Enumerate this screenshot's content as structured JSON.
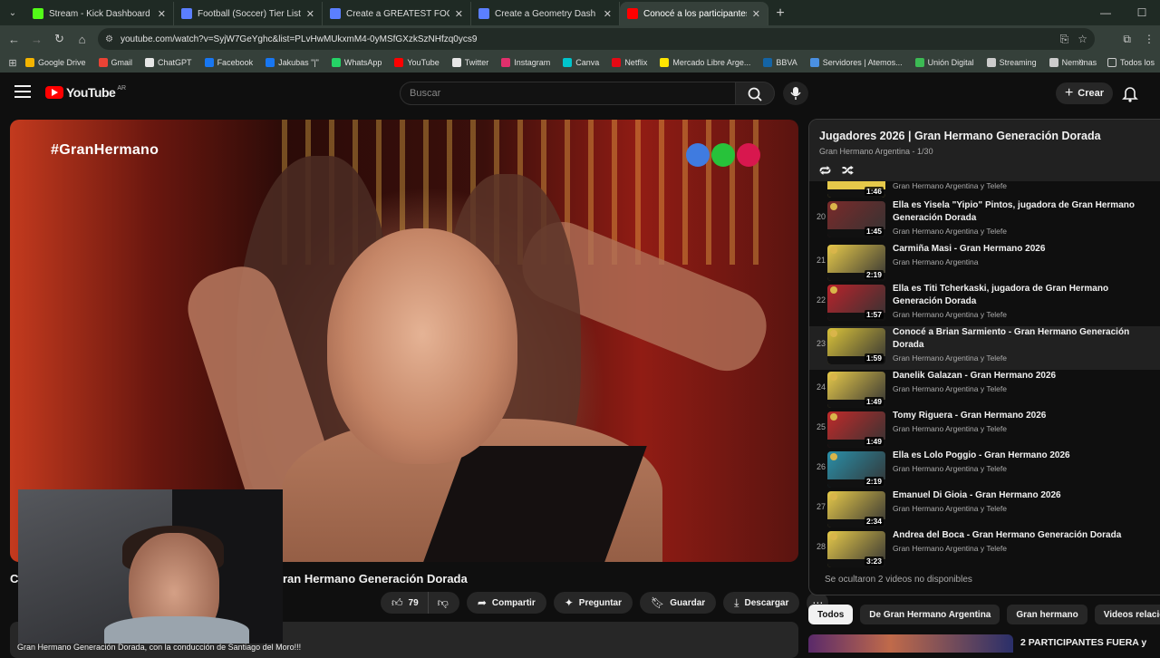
{
  "browser": {
    "tabs": [
      {
        "title": "Stream - Kick Dashboard",
        "fav_color": "#53fc18"
      },
      {
        "title": "Football (Soccer) Tier List Temp",
        "fav_color": "#5b7fff"
      },
      {
        "title": "Create a GREATEST FOOTBALLE",
        "fav_color": "#5b7fff"
      },
      {
        "title": "Create a Geometry Dash Cube",
        "fav_color": "#5b7fff"
      },
      {
        "title": "Conocé a los participantes: Lu",
        "fav_color": "#ff0000",
        "active": true
      }
    ],
    "url": "youtube.com/watch?v=SyjW7GeYghc&list=PLvHwMUkxmM4-0yMSfGXzkSzNHfzq0ycs9",
    "bookmarks": [
      {
        "label": "Google Drive",
        "color": "#f4b400"
      },
      {
        "label": "Gmail",
        "color": "#ea4335"
      },
      {
        "label": "ChatGPT",
        "color": "#e6e6e6"
      },
      {
        "label": "Facebook",
        "color": "#1877f2"
      },
      {
        "label": "Jakubas \"|\"",
        "color": "#1877f2"
      },
      {
        "label": "WhatsApp",
        "color": "#25d366"
      },
      {
        "label": "YouTube",
        "color": "#ff0000"
      },
      {
        "label": "Twitter",
        "color": "#e6e6e6"
      },
      {
        "label": "Instagram",
        "color": "#e1306c"
      },
      {
        "label": "Canva",
        "color": "#00c4cc"
      },
      {
        "label": "Netflix",
        "color": "#e50914"
      },
      {
        "label": "Mercado Libre Arge...",
        "color": "#ffe600"
      },
      {
        "label": "BBVA",
        "color": "#1464a5"
      },
      {
        "label": "Servidores | Atemos...",
        "color": "#4a90e2"
      },
      {
        "label": "Unión Digital",
        "color": "#3cba54"
      },
      {
        "label": "Streaming",
        "color": "#cccccc"
      },
      {
        "label": "Nemunas",
        "color": "#cccccc"
      }
    ],
    "all_bookmarks": "Todos los"
  },
  "yt": {
    "logo": "YouTube",
    "country": "AR",
    "search_placeholder": "Buscar",
    "create_label": "Crear"
  },
  "video": {
    "overlay_tag": "#GranHermano",
    "title_start": "C",
    "title_visible": "ran Hermano Generación Dorada",
    "likes": "79",
    "share": "Compartir",
    "ask": "Preguntar",
    "save": "Guardar",
    "download": "Descargar",
    "description": "Gran Hermano Generación Dorada, con la conducción de Santiago del Moro!!!"
  },
  "playlist": {
    "title": "Jugadores 2026 | Gran Hermano Generación Dorada",
    "subtitle": "Gran Hermano Argentina - 1/30",
    "partial_item": {
      "duration": "1:46",
      "channel": "Gran Hermano Argentina y Telefe"
    },
    "items": [
      {
        "index": "20",
        "title": "Ella es Yisela \"Yipio\" Pintos, jugadora de Gran Hermano Generación Dorada",
        "channel": "Gran Hermano Argentina y Telefe",
        "duration": "1:45",
        "color": "#7a2a2a"
      },
      {
        "index": "21",
        "title": "Carmiña Masi - Gran Hermano 2026",
        "channel": "Gran Hermano Argentina",
        "duration": "2:19",
        "color": "#e6c94a"
      },
      {
        "index": "22",
        "title": "Ella es Titi Tcherkaski, jugadora de Gran Hermano Generación Dorada",
        "channel": "Gran Hermano Argentina y Telefe",
        "duration": "1:57",
        "color": "#b8232b"
      },
      {
        "index": "23",
        "title": "Conocé a Brian Sarmiento - Gran Hermano Generación Dorada",
        "channel": "Gran Hermano Argentina y Telefe",
        "duration": "1:59",
        "color": "#d9c23a",
        "active": true
      },
      {
        "index": "24",
        "title": "Danelik Galazan - Gran Hermano 2026",
        "channel": "Gran Hermano Argentina y Telefe",
        "duration": "1:49",
        "color": "#e6c94a"
      },
      {
        "index": "25",
        "title": "Tomy Riguera - Gran Hermano 2026",
        "channel": "Gran Hermano Argentina y Telefe",
        "duration": "1:49",
        "color": "#c02a2a"
      },
      {
        "index": "26",
        "title": "Ella es Lolo Poggio - Gran Hermano 2026",
        "channel": "Gran Hermano Argentina y Telefe",
        "duration": "2:19",
        "color": "#2a8fa8"
      },
      {
        "index": "27",
        "title": "Emanuel Di Gioia - Gran Hermano 2026",
        "channel": "Gran Hermano Argentina y Telefe",
        "duration": "2:34",
        "color": "#e6c94a"
      },
      {
        "index": "28",
        "title": "Andrea del Boca - Gran Hermano Generación Dorada",
        "channel": "Gran Hermano Argentina y Telefe",
        "duration": "3:23",
        "color": "#e6c94a"
      }
    ],
    "hidden_note": "Se ocultaron 2 videos no disponibles"
  },
  "chips": [
    "Todos",
    "De Gran Hermano Argentina",
    "Gran hermano",
    "Videos relacionados"
  ],
  "recommended": {
    "title": "2 PARTICIPANTES FUERA y"
  }
}
